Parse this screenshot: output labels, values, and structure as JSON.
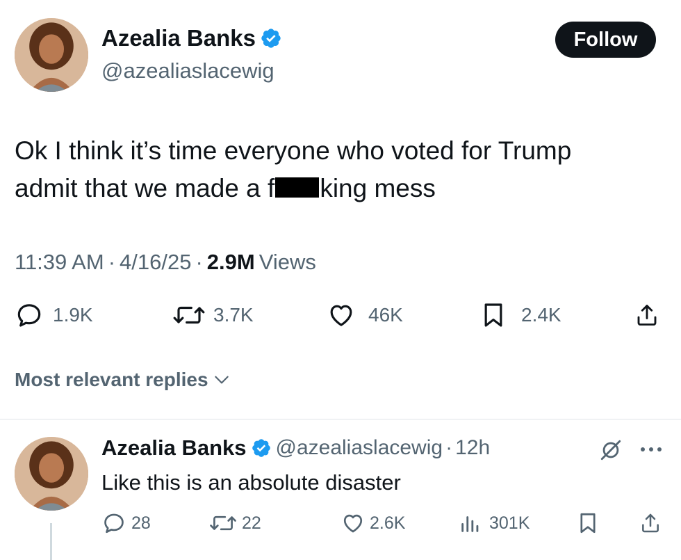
{
  "tweet": {
    "author_name": "Azealia Banks",
    "handle": "@azealiaslacewig",
    "follow_label": "Follow",
    "text_line1": "Ok I think it’s time everyone who voted for Trump",
    "text_line2_a": "admit that we made a f",
    "text_line2_b": "king mess",
    "time": "11:39 AM",
    "date": "4/16/25",
    "views_count": "2.9M",
    "views_label": "Views",
    "sep": "·",
    "stats": {
      "replies": "1.9K",
      "reposts": "3.7K",
      "likes": "46K",
      "bookmarks": "2.4K"
    }
  },
  "replies_sort_label": "Most relevant replies",
  "reply": {
    "author_name": "Azealia Banks",
    "handle": "@azealiaslacewig",
    "sep": "·",
    "age": "12h",
    "text": "Like this is an absolute disaster",
    "stats": {
      "replies": "28",
      "reposts": "22",
      "likes": "2.6K",
      "views": "301K"
    }
  },
  "colors": {
    "text": "#0f1419",
    "secondary": "#536471",
    "verified": "#1d9bf0",
    "button": "#0f1419",
    "divider": "#dfe4e8"
  },
  "icons": [
    "verified-icon",
    "reply-icon",
    "repost-icon",
    "like-icon",
    "bookmark-icon",
    "share-icon",
    "chevron-down-icon",
    "views-icon",
    "grok-icon",
    "more-icon"
  ]
}
